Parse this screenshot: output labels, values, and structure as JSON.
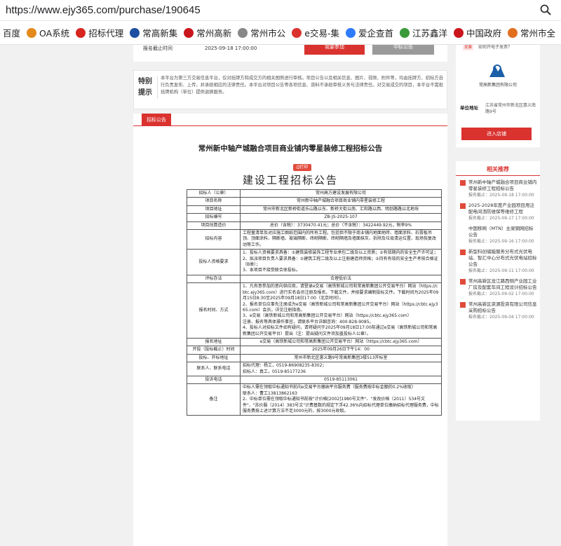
{
  "browser": {
    "url": "https://www.ejy365.com/purchase/190645",
    "zoom_icon": "magnifier-icon",
    "bookmarks": [
      {
        "label": "百度",
        "color": ""
      },
      {
        "label": "OA系统",
        "color": "#e38a1c"
      },
      {
        "label": "招标代理",
        "color": "#d6251f"
      },
      {
        "label": "常高新集",
        "color": "#1c4fa1"
      },
      {
        "label": "常州高新",
        "color": "#c9161d"
      },
      {
        "label": "常州市公",
        "color": "#888888"
      },
      {
        "label": "e交易-集",
        "color": "#d9322f"
      },
      {
        "label": "爱企查首",
        "color": "#2e7bff"
      },
      {
        "label": "江苏鑫洋",
        "color": "#3a9a3a"
      },
      {
        "label": "中国政府",
        "color": "#c9161d"
      },
      {
        "label": "常州市全",
        "color": "#e07020"
      }
    ]
  },
  "top": {
    "deadline_label": "报名截止时间",
    "deadline_value": "2025-09-18 17:00:00",
    "btn_signup": "我要参加",
    "btn_gray": "中标公告"
  },
  "notice_box": {
    "title": "特别提示",
    "text": "本平台为第三方交易信息平台，仅对挂牌方和成交方的相关图照进行审核。项目公告以及相关信息、图片、视频、附件等，均由挂牌方、招标方自行负责发布、上传，并承担相应的法律责任。本平台对项目公告等各项信息、资料不承担审核义务与法律责任。对交易成交的项目，本平台不需担挂牌机构（单位）提供退换服务。"
  },
  "tab": {
    "label": "招标公告"
  },
  "article": {
    "title": "常州新中轴产城融合项目商业铺内零星装修工程招标公告",
    "print": "打印",
    "subtitle": "建设工程招标公告"
  },
  "rows": [
    {
      "k": "招标人（公章）",
      "v": "常州高方建设发展有限公司",
      "align": "center"
    },
    {
      "k": "项目名称",
      "v": "常州新中轴产城融合项目商业铺内零星装修工程",
      "align": "center"
    },
    {
      "k": "项目地址",
      "v": "常州市新北区新桥街道乐山路以东、新桥大街以南、汇和路以西、明劲路路以北地块",
      "align": "center"
    },
    {
      "k": "招标编号",
      "v": "ZB-JS-2025-107",
      "align": "center"
    },
    {
      "k": "项目估算造价",
      "v": "总价（含税）：3730470.41元；总价（不含税）：3422449.92元，税率9%",
      "align": "center"
    },
    {
      "k": "招标内容",
      "v": "工程量清单及对应施工图纸范围内的所有工程。包括但不限于商业铺内地面地砖、墙面涂料、石膏板吊顶、顶面涂料、隔断墙、玻璃隔断、砖砌隔断、砖砌隔墙及墙面抹灰、拆除及垃圾清运位置、现场恢复改动等工作。",
      "align": "left"
    },
    {
      "k": "投标人资格要求",
      "v": "1、投标人资格要求具备：①建筑装修装饰工程专业承包二级及以上资质；②有效期内的安全生产许可证；\n2、拟派项目负责人要求具备：①建筑工程二级及以上注册建造师资格；②持有有效的安全生产考核合格证（B类）；\n3、本项目不接受联合体投标。",
      "align": "left"
    },
    {
      "k": "评标办法",
      "v": "合理低价法",
      "align": "center"
    },
    {
      "k": "报名时间、方式",
      "v": "1、凡有意参加的意向供应商，请登录e交易（高铁新城公司和常高新集团公开交易平台）网站（https://cbtc.ejy365.com）进行实名会员注册及报名、下载文件，并按要求编制投标文件。下载时间为2025年09月15日8:30至2025年09月18日17:00（北京时间）。\n2、报名单位应事先注册成为e交易（高铁新城公司和常高新集团公开交易平台）网站（https://cbtc.ejy365.com）会员，详见注册指南。\n3、e交易（高铁新城公司和常高新集团公开交易平台）网站（https://cbtc.ejy365.com）\n注册、报名等具体操作事宜，请联系平台详细咨询：400-828-9085。\n4、投标人对招标文件如有疑问，请将疑问于2025年09月18日17:00前通过e交易（高铁新城公司和常高新集团公开交易平台）提出（注：提出疑问文件须加盖投标人公章）。",
      "align": "left"
    },
    {
      "k": "报名地址",
      "v": "e交易（高铁新城公司和常高新集团公开交易平台）网站（https://cbtc.ejy365.com）",
      "align": "center"
    },
    {
      "k": "开投（投标截止）时间",
      "v": "2025年09月26日下午14：00",
      "align": "center"
    },
    {
      "k": "投标、开标地址",
      "v": "常州市新北区惠义路9号常高新集团3楼513开标室",
      "align": "center"
    },
    {
      "k": "联系人、联系电话",
      "v": "招标代理：杨工，0519-86908235-8302；\n招标人：袁工，0519-85177236",
      "align": "left"
    },
    {
      "k": "投诉电话",
      "v": "0519-85113061",
      "align": "center"
    },
    {
      "k": "备注",
      "v": "中标人需在领取中标通知书前向e交易平台缴纳平台服务费（服务费按中标金额的0.2%收取）\n联系人：曹工13813862163\n2、中标单位需在领取中标通知书前按\"计价格[2002]1980号文件\"、\"发改价格（2011）534号文件\"、\"苏价服（2014）383号文\"计费基数的规定下浮42.36%向招标代理单位缴纳招标代理服务费，中标服务费按上述计算方法不足3000元的，按3000元收取。",
      "align": "left"
    }
  ],
  "sidebar": {
    "question_badge": "发票",
    "question_text": "如何开电子发票？",
    "company_logo": "company-logo",
    "company_name": "常高新集团有限公司",
    "unit_label": "单位地址",
    "unit_value": "江苏省常州市新北区惠义南路9号",
    "enter_btn": "进入店铺",
    "rec_title": "相关推荐",
    "recs": [
      {
        "t": "常州新中轴产城融合项目商业铺内零星装修工程招标公告",
        "d": "报名截止：2025-09-18 17:00:00",
        "icon": true
      },
      {
        "t": "2025-2028年度产业园项目用泛配电间消防维保等维修工程",
        "d": "报名截止：2025-09-17 17:00:00",
        "icon": true
      },
      {
        "t": "中国移网（MTN）主梁钢网招标公告",
        "d": "报名截止：2025-09-16 17:00:00",
        "icon": false
      },
      {
        "t": "新型科创储能服务分布式光伏电站、智汇中心分布式光伏电站招标公告",
        "d": "报名截止：2025-09-11 17:00:00",
        "icon": true
      },
      {
        "t": "常州高新区龙江路西侧产业园工业厂房及配套车间工程设计招标公告",
        "d": "报名截止：2025-09-02 17:00:00",
        "icon": true
      },
      {
        "t": "常州高新区资源投资有限公司信息采购招标公告",
        "d": "报名截止：2025-09-04 17:00:00",
        "icon": true
      }
    ]
  }
}
